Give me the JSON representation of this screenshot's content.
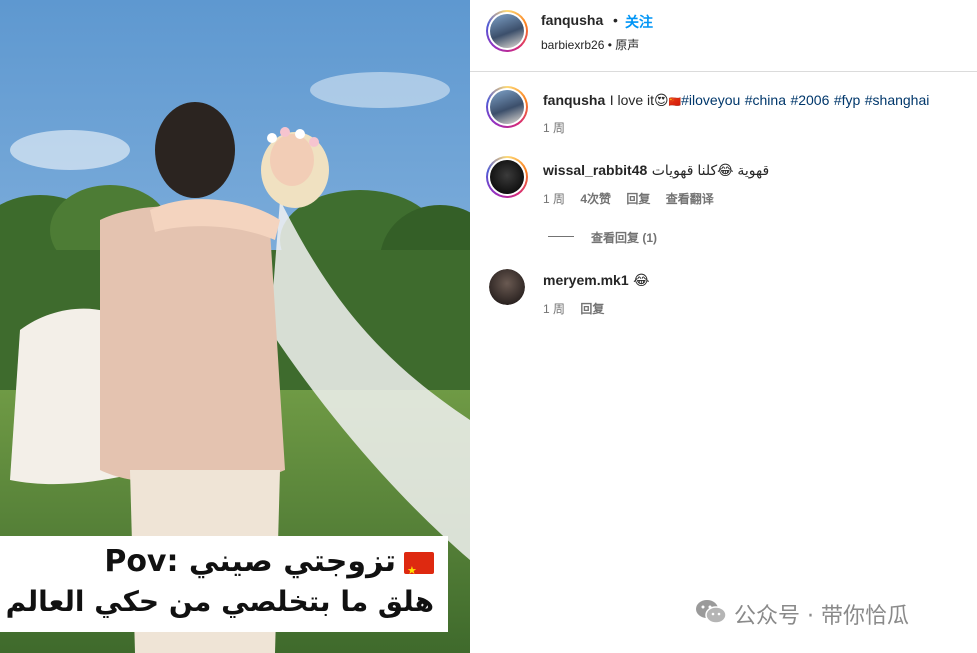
{
  "post": {
    "author": "fanqusha",
    "follow_label": "关注",
    "dot": "•",
    "audio_user": "barbiexrb26",
    "audio_label": "原声",
    "audio_sep": "•"
  },
  "media": {
    "caption_line1": "تزوجتي صيني :Pov",
    "caption_line2": "هلق ما بتخلصي من حكي العالم"
  },
  "caption": {
    "user": "fanqusha",
    "text": "I love it",
    "emoji": "😍",
    "flag": "🇨🇳",
    "hashtags": [
      "#iloveyou",
      "#china",
      "#2006",
      "#fyp",
      "#shanghai"
    ],
    "time": "1 周"
  },
  "comments": [
    {
      "user": "wissal_rabbit48",
      "text": "قهوية 😂كلنا قهويات",
      "time": "1 周",
      "likes": "4次赞",
      "reply": "回复",
      "translate": "查看翻译",
      "view_replies": "查看回复 (1)"
    },
    {
      "user": "meryem.mk1",
      "text": "😂",
      "time": "1 周",
      "reply": "回复"
    }
  ],
  "watermark": {
    "text": "公众号 · 带你恰瓜"
  },
  "colors": {
    "accent": "#0095f6",
    "hashtag": "#00376b",
    "muted": "#737373"
  }
}
